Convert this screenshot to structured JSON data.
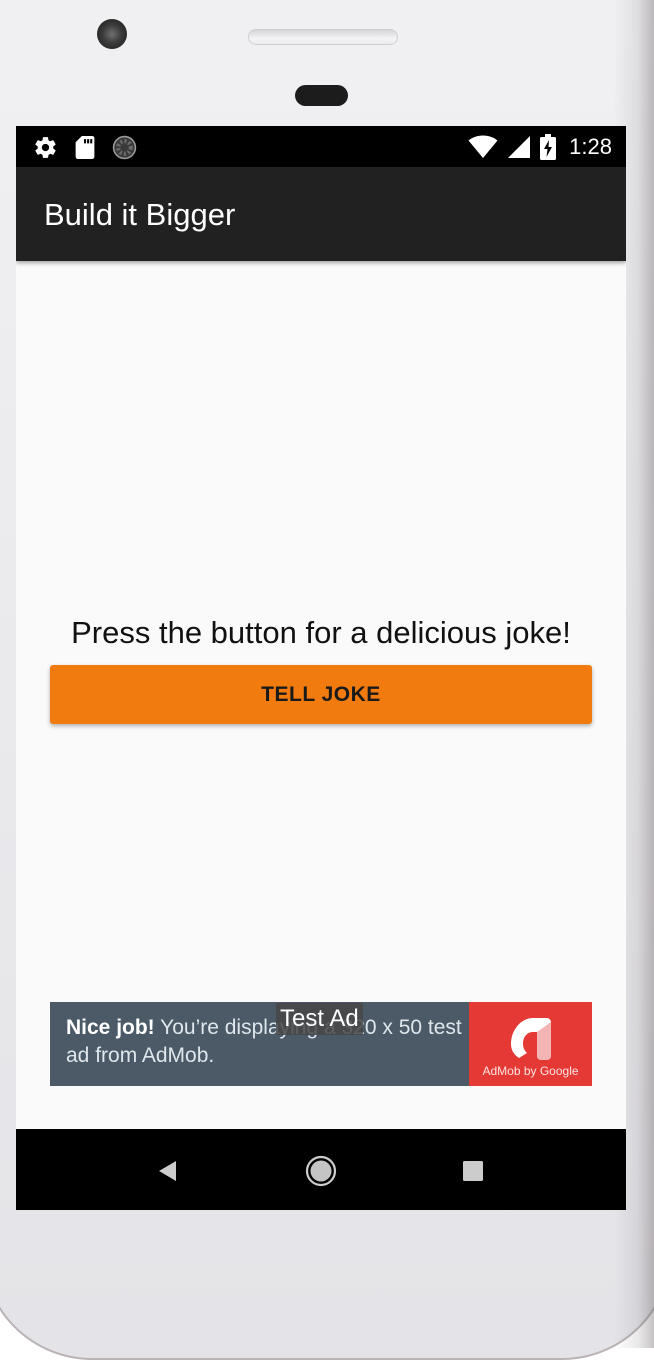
{
  "status_bar": {
    "time": "1:28",
    "left_icons": [
      "gear-icon",
      "sd-card-icon",
      "sync-icon"
    ],
    "right_icons": [
      "wifi-icon",
      "cell-signal-icon",
      "battery-charging-icon"
    ]
  },
  "app_bar": {
    "title": "Build it Bigger"
  },
  "main": {
    "instructions": "Press the button for a delicious joke!",
    "button_label": "TELL JOKE"
  },
  "ad": {
    "label": "Test Ad",
    "text_lead": "Nice job!",
    "text_body": " You’re displaying a 320 x 50 test ad from AdMob.",
    "logo_caption": "AdMob by Google",
    "panel_color": "#e53935",
    "banner_color": "#4b5a66"
  },
  "nav_bar": {
    "icons": [
      "back-icon",
      "home-icon",
      "recents-icon"
    ]
  },
  "colors": {
    "accent": "#f27b0f",
    "app_bar": "#212121",
    "background": "#fafafa"
  }
}
